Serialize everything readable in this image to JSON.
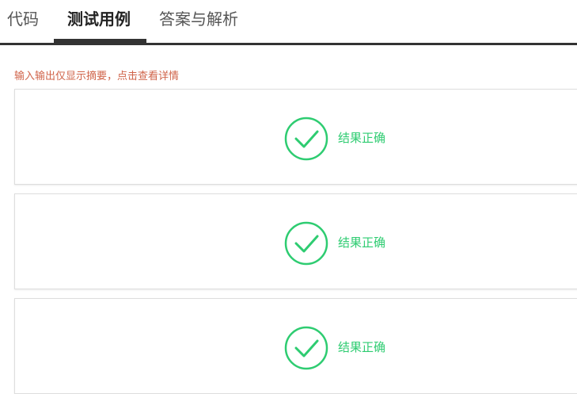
{
  "tabs": [
    {
      "label": "代码"
    },
    {
      "label": "测试用例"
    },
    {
      "label": "答案与解析"
    }
  ],
  "note": "输入输出仅显示摘要，点击查看详情",
  "test_cases": [
    {
      "status": "结果正确"
    },
    {
      "status": "结果正确"
    },
    {
      "status": "结果正确"
    }
  ],
  "colors": {
    "success": "#2ecc71",
    "note": "#d0644a",
    "tab_active_underline": "#333333"
  },
  "icons": {
    "result": "check-circle-icon"
  }
}
